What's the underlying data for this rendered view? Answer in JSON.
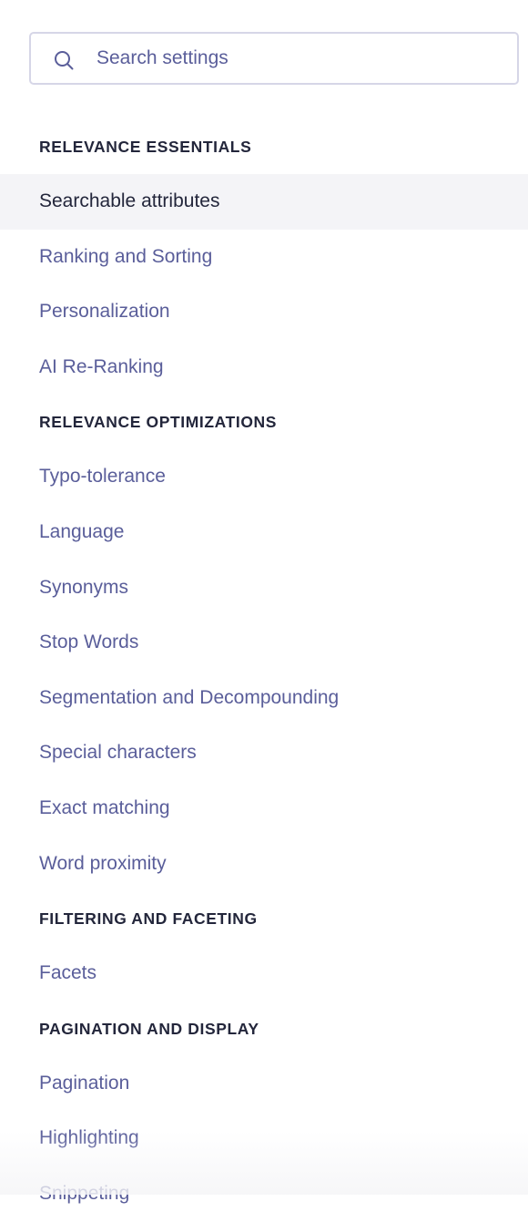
{
  "search": {
    "placeholder": "Search settings",
    "value": ""
  },
  "sections": [
    {
      "header": "RELEVANCE ESSENTIALS",
      "items": [
        {
          "label": "Searchable attributes",
          "active": true
        },
        {
          "label": "Ranking and Sorting"
        },
        {
          "label": "Personalization"
        },
        {
          "label": "AI Re-Ranking"
        }
      ]
    },
    {
      "header": "RELEVANCE OPTIMIZATIONS",
      "items": [
        {
          "label": "Typo-tolerance"
        },
        {
          "label": "Language"
        },
        {
          "label": "Synonyms"
        },
        {
          "label": "Stop Words"
        },
        {
          "label": "Segmentation and Decompounding"
        },
        {
          "label": "Special characters"
        },
        {
          "label": "Exact matching"
        },
        {
          "label": "Word proximity"
        }
      ]
    },
    {
      "header": "FILTERING AND FACETING",
      "items": [
        {
          "label": "Facets"
        }
      ]
    },
    {
      "header": "PAGINATION AND DISPLAY",
      "items": [
        {
          "label": "Pagination"
        },
        {
          "label": "Highlighting"
        },
        {
          "label": "Snippeting"
        }
      ]
    }
  ],
  "colors": {
    "header_text": "#23263b",
    "link_text": "#5a5e9a",
    "active_bg": "#f4f4f7",
    "search_border": "#d6d6e7"
  },
  "icons": {
    "search": "search-icon"
  }
}
